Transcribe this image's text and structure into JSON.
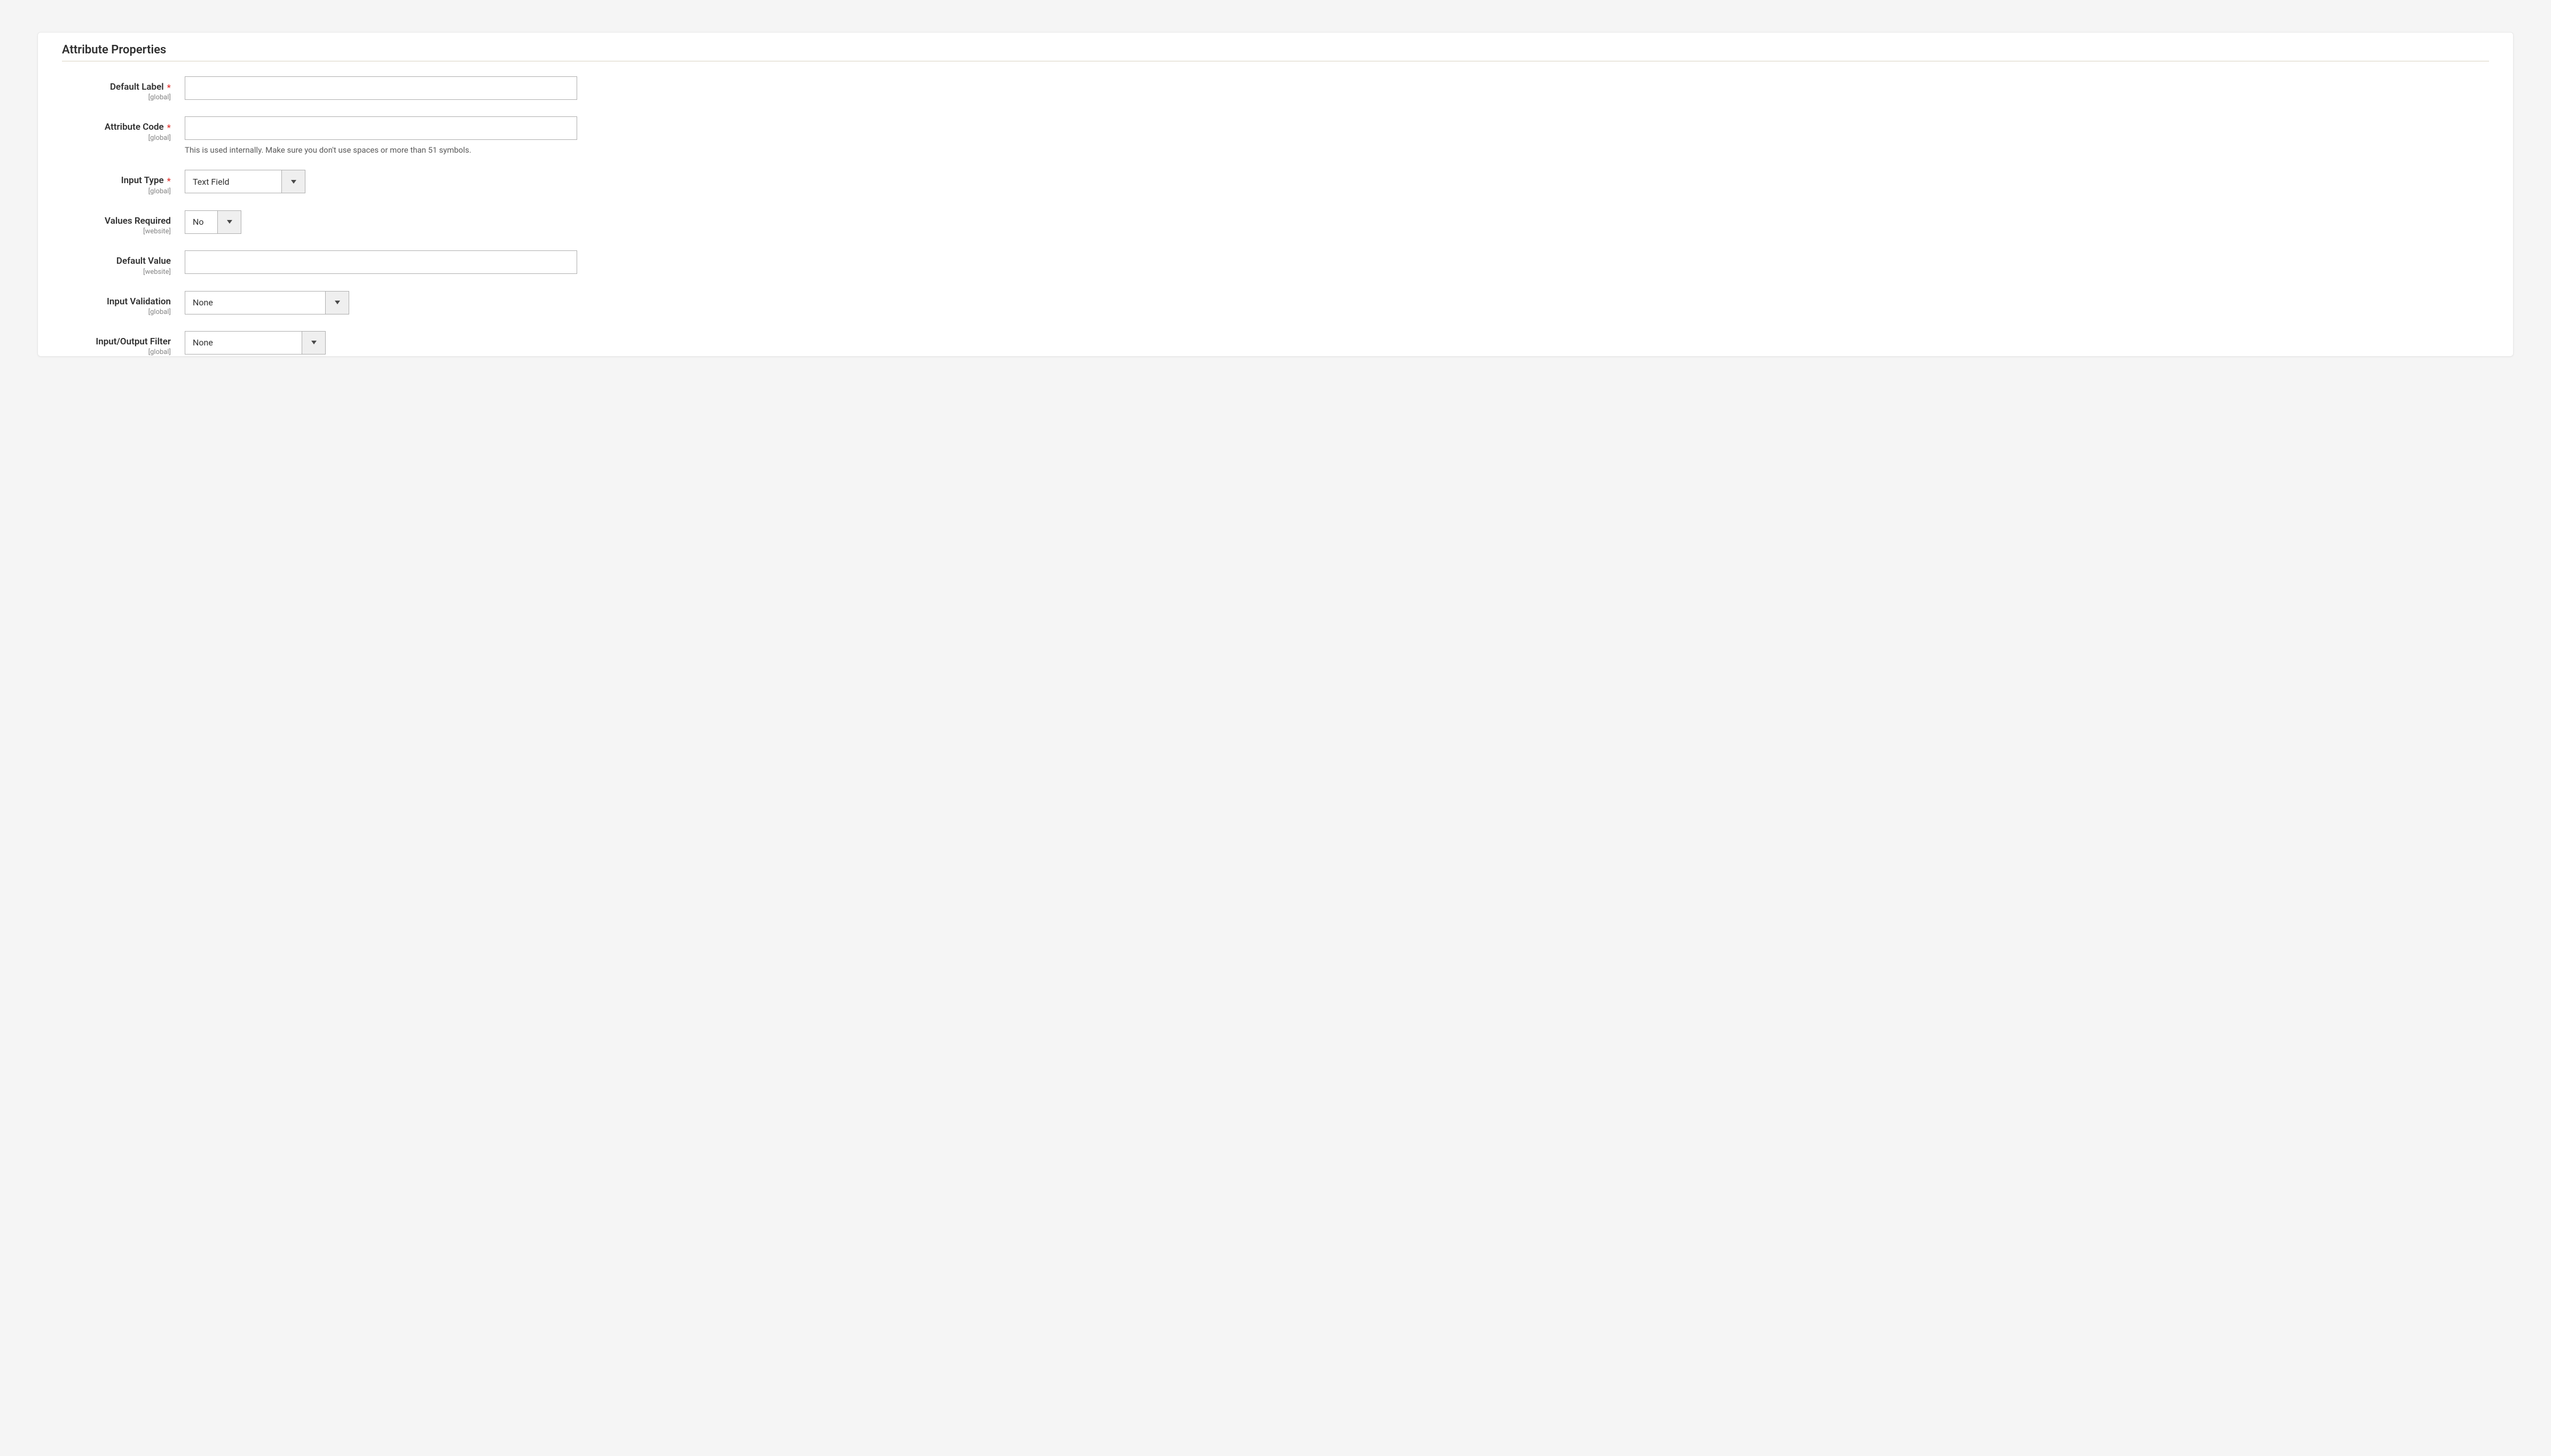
{
  "panel": {
    "title": "Attribute Properties"
  },
  "fields": {
    "default_label": {
      "label": "Default Label",
      "scope": "[global]",
      "required": "*",
      "value": ""
    },
    "attribute_code": {
      "label": "Attribute Code",
      "scope": "[global]",
      "required": "*",
      "value": "",
      "hint": "This is used internally. Make sure you don't use spaces or more than 51 symbols."
    },
    "input_type": {
      "label": "Input Type",
      "scope": "[global]",
      "required": "*",
      "value": "Text Field"
    },
    "values_required": {
      "label": "Values Required",
      "scope": "[website]",
      "value": "No"
    },
    "default_value": {
      "label": "Default Value",
      "scope": "[website]",
      "value": ""
    },
    "input_validation": {
      "label": "Input Validation",
      "scope": "[global]",
      "value": "None"
    },
    "io_filter": {
      "label": "Input/Output Filter",
      "scope": "[global]",
      "value": "None"
    }
  }
}
